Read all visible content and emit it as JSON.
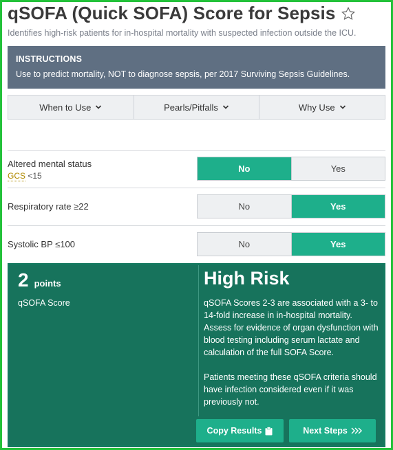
{
  "header": {
    "title": "qSOFA (Quick SOFA) Score for Sepsis",
    "subtitle": "Identifies high-risk patients for in-hospital mortality with suspected infection outside the ICU."
  },
  "instructions": {
    "heading": "INSTRUCTIONS",
    "body": "Use to predict mortality, NOT to diagnose sepsis, per 2017 Surviving Sepsis Guidelines."
  },
  "tabs": [
    {
      "label": "When to Use"
    },
    {
      "label": "Pearls/Pitfalls"
    },
    {
      "label": "Why Use"
    }
  ],
  "criteria": [
    {
      "label": "Altered mental status",
      "sub_link": "GCS",
      "sub_rest": " <15",
      "no": "No",
      "yes": "Yes",
      "selected": "No"
    },
    {
      "label": "Respiratory rate ≥22",
      "no": "No",
      "yes": "Yes",
      "selected": "Yes"
    },
    {
      "label": "Systolic BP ≤100",
      "no": "No",
      "yes": "Yes",
      "selected": "Yes"
    }
  ],
  "result": {
    "score": "2",
    "score_unit": "points",
    "score_label": "qSOFA Score",
    "risk": "High Risk",
    "desc1": "qSOFA Scores 2-3 are associated with a 3- to 14-fold increase in in-hospital mortality. Assess for evidence of organ dysfunction with blood testing including serum lactate and calculation of the full SOFA Score.",
    "desc2": "Patients meeting these qSOFA criteria should have infection considered even if it was previously not.",
    "copy_label": "Copy Results",
    "next_label": "Next Steps"
  },
  "colors": {
    "accent": "#1eaf8b",
    "result_bg": "#17735c",
    "instructions_bg": "#5f6f82",
    "frame": "#23c23a"
  }
}
